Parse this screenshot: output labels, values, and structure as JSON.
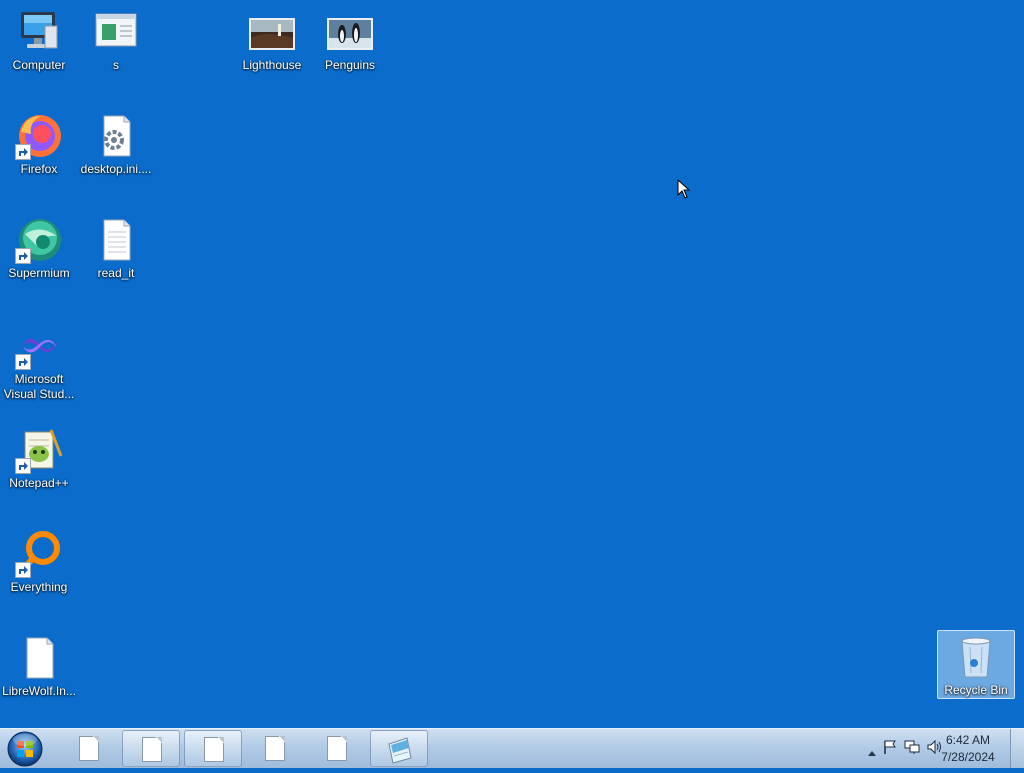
{
  "desktop": {
    "icons": {
      "computer": {
        "label": "Computer"
      },
      "s": {
        "label": "s"
      },
      "lighthouse": {
        "label": "Lighthouse"
      },
      "penguins": {
        "label": "Penguins"
      },
      "firefox": {
        "label": "Firefox"
      },
      "desktop_ini": {
        "label": "desktop.ini...."
      },
      "supermium": {
        "label": "Supermium"
      },
      "read_it": {
        "label": "read_it"
      },
      "visual_studio": {
        "label": "Microsoft Visual Stud..."
      },
      "notepadpp": {
        "label": "Notepad++"
      },
      "everything": {
        "label": "Everything"
      },
      "librewolf": {
        "label": "LibreWolf.In..."
      },
      "recycle_bin": {
        "label": "Recycle Bin"
      }
    }
  },
  "taskbar": {
    "clock": {
      "time": "6:42 AM",
      "date": "7/28/2024"
    },
    "buttons": [
      {
        "icon": "text-document-icon",
        "active": false
      },
      {
        "icon": "text-document-icon",
        "active": true
      },
      {
        "icon": "text-document-icon",
        "active": true
      },
      {
        "icon": "text-document-icon",
        "active": false
      },
      {
        "icon": "text-document-icon",
        "active": false
      },
      {
        "icon": "notepad-icon",
        "active": true
      }
    ],
    "tray_icons": [
      "show-hidden-icons-arrow",
      "action-center-flag-icon",
      "network-icon",
      "volume-icon"
    ]
  },
  "colors": {
    "desktop_background": "#0b6ccb",
    "taskbar": "#b2cbe6"
  }
}
